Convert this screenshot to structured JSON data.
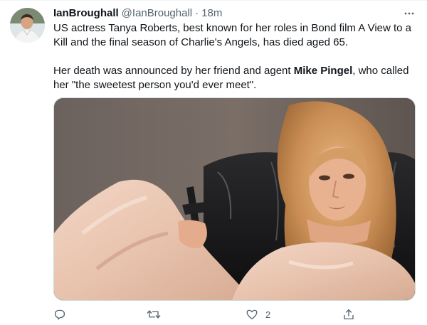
{
  "tweet": {
    "author": {
      "display_name": "IanBroughall",
      "handle": "@IanBroughall",
      "separator": "·",
      "time": "18m"
    },
    "text": {
      "paragraph1": "US actress Tanya Roberts, best known for her roles in Bond film A View to a Kill and the final season of Charlie's Angels, has died aged 65.",
      "paragraph2_before": "Her death was announced by her friend and agent ",
      "paragraph2_mention": "Mike Pingel",
      "paragraph2_after": ", who called her \"the sweetest person you'd ever meet\"."
    },
    "actions": {
      "reply_count": "",
      "retweet_count": "",
      "like_count": "2",
      "share_count": ""
    }
  },
  "icons": {
    "more": "more-dots-icon",
    "reply": "reply-icon",
    "retweet": "retweet-icon",
    "like": "heart-icon",
    "share": "share-icon"
  },
  "colors": {
    "text_primary": "#0f1419",
    "text_secondary": "#536471",
    "border": "#cfd9de"
  }
}
